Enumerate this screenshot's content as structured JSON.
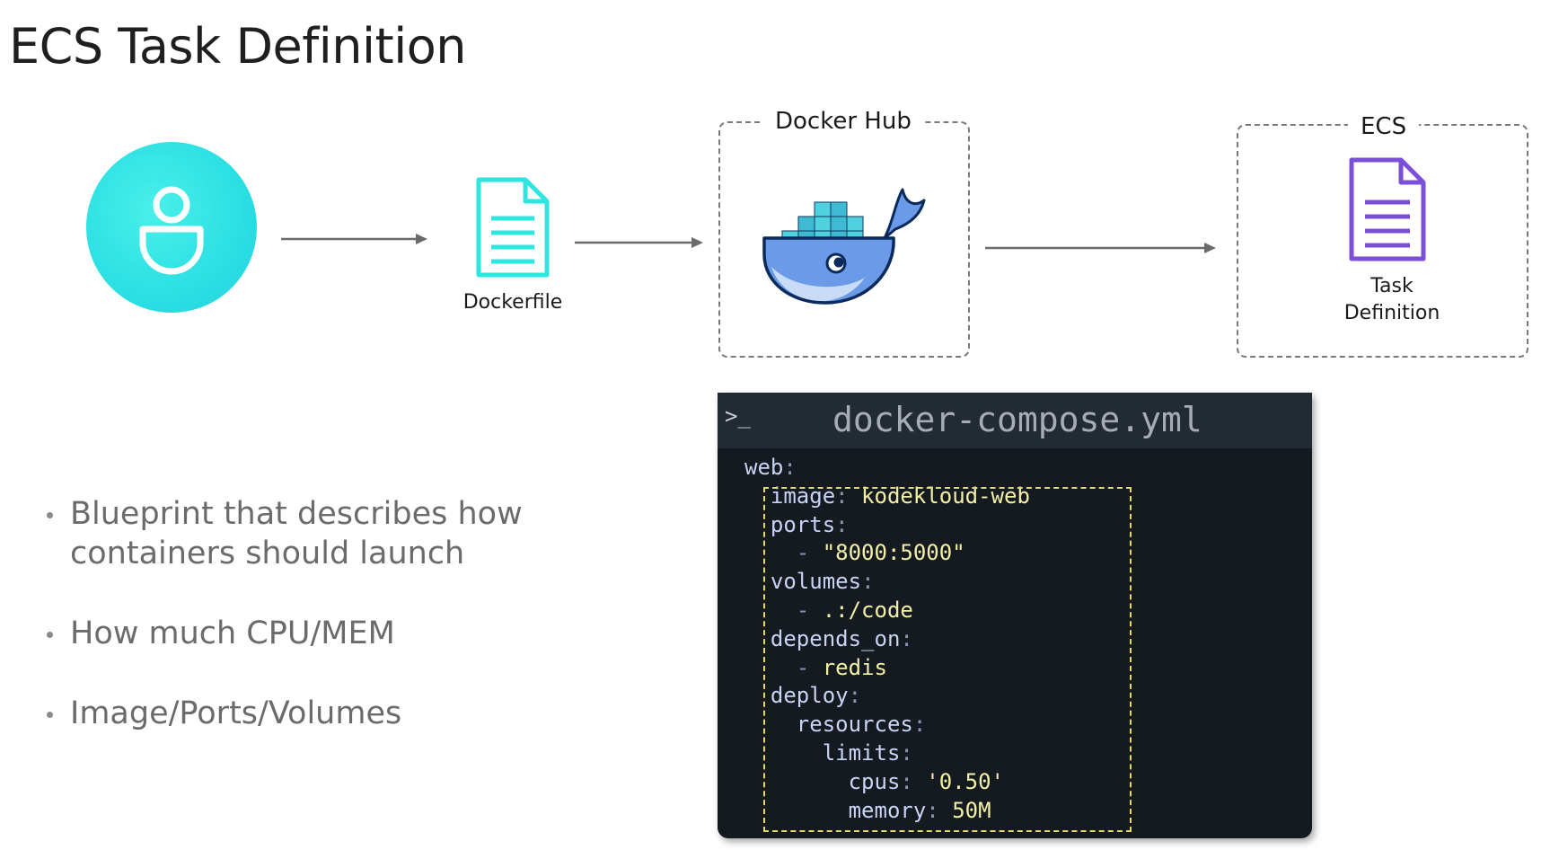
{
  "title": "ECS Task Definition",
  "user": {
    "icon": "user-icon"
  },
  "dockerfile": {
    "label": "Dockerfile",
    "icon": "document-icon",
    "color": "#2ee6e0"
  },
  "docker_hub": {
    "title": "Docker Hub",
    "icon": "docker-whale-icon"
  },
  "ecs": {
    "title": "ECS",
    "task_label_line1": "Task",
    "task_label_line2": "Definition",
    "icon": "document-icon",
    "color": "#7b4fd8"
  },
  "bullets": [
    {
      "text": "Blueprint that describes how containers should launch"
    },
    {
      "text": "How much CPU/MEM"
    },
    {
      "text": "Image/Ports/Volumes"
    }
  ],
  "code": {
    "prompt": ">_",
    "filename": "docker-compose.yml",
    "lines": [
      {
        "indent": "",
        "key": "web",
        "sep": ":",
        "value": ""
      },
      {
        "indent": "  ",
        "key": "image",
        "sep": ": ",
        "value": "kodekloud-web"
      },
      {
        "indent": "  ",
        "key": "ports",
        "sep": ":",
        "value": ""
      },
      {
        "indent": "    ",
        "key": "",
        "sep": "- ",
        "value": "\"8000:5000\""
      },
      {
        "indent": "  ",
        "key": "volumes",
        "sep": ":",
        "value": ""
      },
      {
        "indent": "    ",
        "key": "",
        "sep": "- ",
        "value": ".:/code"
      },
      {
        "indent": "  ",
        "key": "depends_on",
        "sep": ":",
        "value": ""
      },
      {
        "indent": "    ",
        "key": "",
        "sep": "- ",
        "value": "redis"
      },
      {
        "indent": "  ",
        "key": "deploy",
        "sep": ":",
        "value": ""
      },
      {
        "indent": "    ",
        "key": "resources",
        "sep": ":",
        "value": ""
      },
      {
        "indent": "      ",
        "key": "limits",
        "sep": ":",
        "value": ""
      },
      {
        "indent": "        ",
        "key": "cpus",
        "sep": ": ",
        "value": "'0.50'"
      },
      {
        "indent": "        ",
        "key": "memory",
        "sep": ": ",
        "value": "50M"
      }
    ]
  }
}
